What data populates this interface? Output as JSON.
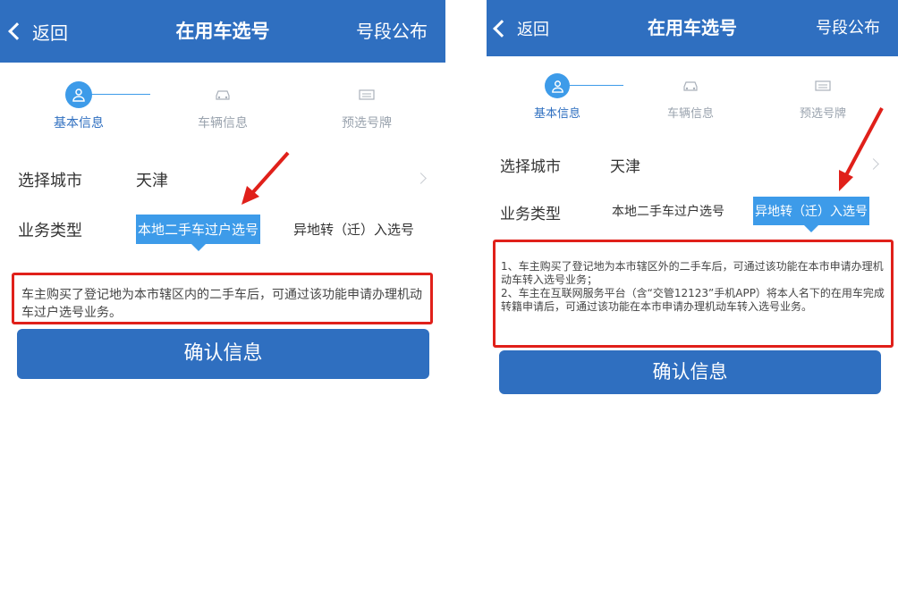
{
  "left": {
    "header": {
      "back": "返回",
      "title": "在用车选号",
      "right": "号段公布"
    },
    "steps": [
      {
        "label": "基本信息",
        "icon": "user-icon"
      },
      {
        "label": "车辆信息",
        "icon": "car-icon"
      },
      {
        "label": "预选号牌",
        "icon": "plate-icon"
      }
    ],
    "city_label": "选择城市",
    "city_value": "天津",
    "type_label": "业务类型",
    "options": [
      "本地二手车过户选号",
      "异地转（迁）入选号"
    ],
    "selected_option": "本地二手车过户选号",
    "notice": "车主购买了登记地为本市辖区内的二手车后，可通过该功能申请办理机动车过户选号业务。",
    "confirm": "确认信息"
  },
  "right": {
    "header": {
      "back": "返回",
      "title": "在用车选号",
      "right": "号段公布"
    },
    "steps": [
      {
        "label": "基本信息",
        "icon": "user-icon"
      },
      {
        "label": "车辆信息",
        "icon": "car-icon"
      },
      {
        "label": "预选号牌",
        "icon": "plate-icon"
      }
    ],
    "city_label": "选择城市",
    "city_value": "天津",
    "type_label": "业务类型",
    "options": [
      "本地二手车过户选号",
      "异地转（迁）入选号"
    ],
    "selected_option": "异地转（迁）入选号",
    "notice_lines": [
      "1、车主购买了登记地为本市辖区外的二手车后，可通过该功能在本市申请办理机动车转入选号业务；",
      "2、车主在互联网服务平台（含“交管12123”手机APP）将本人名下的在用车完成转籍申请后，可通过该功能在本市申请办理机动车转入选号业务。"
    ],
    "confirm": "确认信息"
  },
  "colors": {
    "header": "#2f6fc0",
    "accent": "#3d9be9",
    "highlight_box": "#e0201a"
  }
}
